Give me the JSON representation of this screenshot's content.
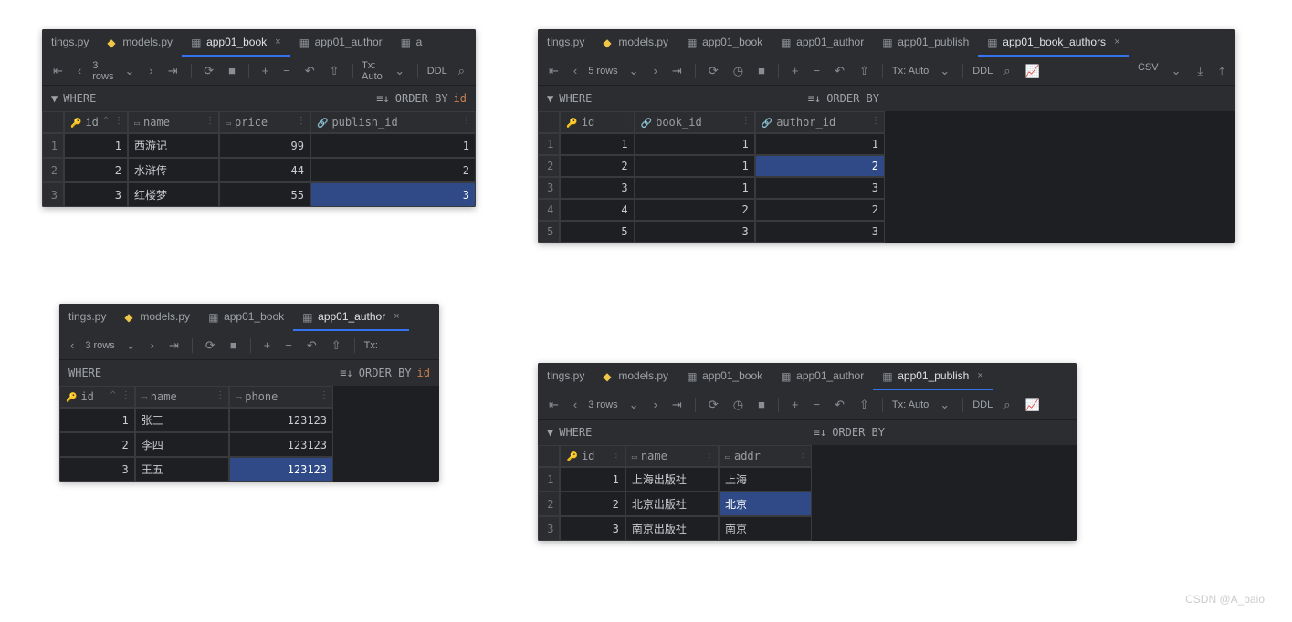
{
  "watermark": "CSDN @A_baio",
  "common": {
    "where": "WHERE",
    "orderby": "ORDER BY",
    "tx": "Tx: Auto",
    "ddl": "DDL",
    "csv": "CSV"
  },
  "tabs": {
    "tings": "tings.py",
    "models": "models.py",
    "book": "app01_book",
    "author": "app01_author",
    "publish": "app01_publish",
    "book_authors": "app01_book_authors",
    "a": "a"
  },
  "w1": {
    "rows_label": "3 rows",
    "orderby_val": "id",
    "cols": {
      "id": "id",
      "name": "name",
      "price": "price",
      "publish_id": "publish_id"
    },
    "data": [
      {
        "n": "1",
        "id": "1",
        "name": "西游记",
        "price": "99",
        "publish_id": "1"
      },
      {
        "n": "2",
        "id": "2",
        "name": "水浒传",
        "price": "44",
        "publish_id": "2"
      },
      {
        "n": "3",
        "id": "3",
        "name": "红楼梦",
        "price": "55",
        "publish_id": "3"
      }
    ]
  },
  "w2": {
    "rows_label": "5 rows",
    "cols": {
      "id": "id",
      "book_id": "book_id",
      "author_id": "author_id"
    },
    "data": [
      {
        "n": "1",
        "id": "1",
        "book_id": "1",
        "author_id": "1"
      },
      {
        "n": "2",
        "id": "2",
        "book_id": "1",
        "author_id": "2"
      },
      {
        "n": "3",
        "id": "3",
        "book_id": "1",
        "author_id": "3"
      },
      {
        "n": "4",
        "id": "4",
        "book_id": "2",
        "author_id": "2"
      },
      {
        "n": "5",
        "id": "5",
        "book_id": "3",
        "author_id": "3"
      }
    ]
  },
  "w3": {
    "rows_label": "3 rows",
    "orderby_val": "id",
    "cols": {
      "id": "id",
      "name": "name",
      "phone": "phone"
    },
    "data": [
      {
        "n": "",
        "id": "1",
        "name": "张三",
        "phone": "123123"
      },
      {
        "n": "",
        "id": "2",
        "name": "李四",
        "phone": "123123"
      },
      {
        "n": "",
        "id": "3",
        "name": "王五",
        "phone": "123123"
      }
    ]
  },
  "w4": {
    "rows_label": "3 rows",
    "cols": {
      "id": "id",
      "name": "name",
      "addr": "addr"
    },
    "data": [
      {
        "n": "1",
        "id": "1",
        "name": "上海出版社",
        "addr": "上海"
      },
      {
        "n": "2",
        "id": "2",
        "name": "北京出版社",
        "addr": "北京"
      },
      {
        "n": "3",
        "id": "3",
        "name": "南京出版社",
        "addr": "南京"
      }
    ]
  }
}
